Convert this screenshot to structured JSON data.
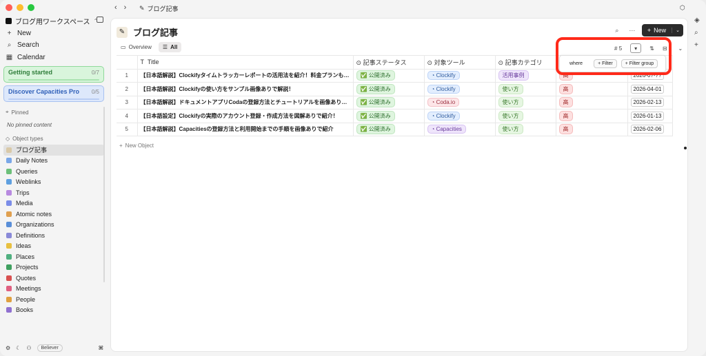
{
  "workspace": {
    "name": "ブログ用ワークスペース"
  },
  "sidebar": {
    "nav": [
      {
        "icon": "+",
        "label": "New"
      },
      {
        "icon": "⌕",
        "label": "Search"
      },
      {
        "icon": "▦",
        "label": "Calendar"
      }
    ],
    "cards": [
      {
        "label": "Getting started",
        "count": "0/7"
      },
      {
        "label": "Discover Capacities Pro",
        "count": "0/5"
      }
    ],
    "pinned_label": "Pinned",
    "no_pinned": "No pinned content",
    "object_types_label": "Object types",
    "object_types": [
      {
        "label": "ブログ記事",
        "color": "#d9c9a8"
      },
      {
        "label": "Daily Notes",
        "color": "#7aa7e8"
      },
      {
        "label": "Queries",
        "color": "#6dc07a"
      },
      {
        "label": "Weblinks",
        "color": "#5fa0e0"
      },
      {
        "label": "Trips",
        "color": "#b88ae0"
      },
      {
        "label": "Media",
        "color": "#7b8de8"
      },
      {
        "label": "Atomic notes",
        "color": "#e0a050"
      },
      {
        "label": "Organizations",
        "color": "#5a8fd8"
      },
      {
        "label": "Definitions",
        "color": "#8a8ad8"
      },
      {
        "label": "Ideas",
        "color": "#e8c040"
      },
      {
        "label": "Places",
        "color": "#50b080"
      },
      {
        "label": "Projects",
        "color": "#40a060"
      },
      {
        "label": "Quotes",
        "color": "#d85050"
      },
      {
        "label": "Meetings",
        "color": "#e06080"
      },
      {
        "label": "People",
        "color": "#e0a040"
      },
      {
        "label": "Books",
        "color": "#9070d0"
      }
    ],
    "bottom": {
      "badge": "Believer"
    }
  },
  "topbar": {
    "title": "ブログ記事"
  },
  "page": {
    "title": "ブログ記事",
    "new_label": "New",
    "views": [
      {
        "icon": "▭",
        "label": "Overview"
      },
      {
        "icon": "☰",
        "label": "All"
      }
    ],
    "count": "5",
    "new_object": "New Object"
  },
  "table": {
    "columns": [
      "Title",
      "記事ステータス",
      "対象ツール",
      "記事カテゴリ"
    ],
    "rows": [
      {
        "idx": "1",
        "title": "【日本語解説】Clockifyタイムトラッカーレポートの活用法を紹介！料金プランも徹底比較",
        "status": "公開済み",
        "tool": "Clockify",
        "tool_style": "p-blue",
        "category": "活用事例",
        "cat_style": "p-purple",
        "priority": "高",
        "date": "2026-0?-??"
      },
      {
        "idx": "2",
        "title": "【日本語解説】Clockifyの使い方をサンプル画像ありで解説！",
        "status": "公開済み",
        "tool": "Clockify",
        "tool_style": "p-blue",
        "category": "使い方",
        "cat_style": "p-lgreen",
        "priority": "高",
        "date": "2026-04-01"
      },
      {
        "idx": "3",
        "title": "【日本語解説】ドキュメントアプリCodaの登録方法とチュートリアルを画像ありで紹介",
        "status": "公開済み",
        "tool": "Coda.io",
        "tool_style": "p-pink",
        "category": "使い方",
        "cat_style": "p-lgreen",
        "priority": "高",
        "date": "2026-02-13"
      },
      {
        "idx": "4",
        "title": "【日本語設定】Clockifyの実際のアカウント登録・作成方法を図解ありで紹介！",
        "status": "公開済み",
        "tool": "Clockify",
        "tool_style": "p-blue",
        "category": "使い方",
        "cat_style": "p-lgreen",
        "priority": "高",
        "date": "2026-01-13"
      },
      {
        "idx": "5",
        "title": "【日本語解説】Capacitiesの登録方法と利用開始までの手順を画像ありで紹介",
        "status": "公開済み",
        "tool": "Capacities",
        "tool_style": "p-purple",
        "category": "使い方",
        "cat_style": "p-lgreen",
        "priority": "高",
        "date": "2026-02-06"
      }
    ]
  },
  "filter": {
    "where": "where",
    "add_filter": "Filter",
    "add_group": "Filter group"
  },
  "colors": {
    "highlight": "#ff2a1a",
    "new_button": "#2b2b2b"
  }
}
